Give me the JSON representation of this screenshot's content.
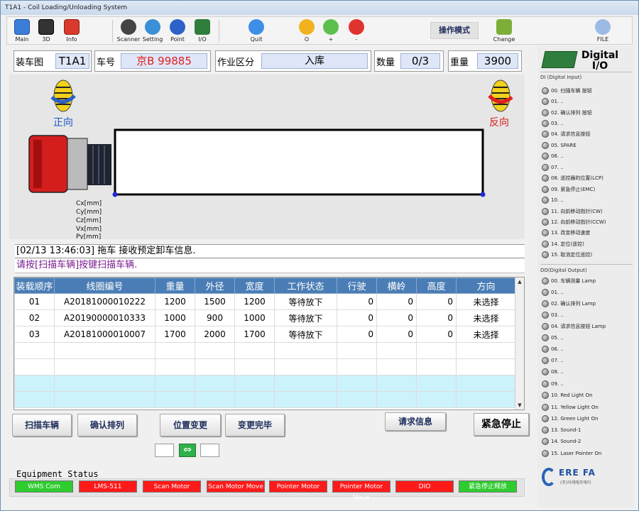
{
  "window": {
    "title": "T1A1 - Coil Loading/Unloading System"
  },
  "toolbar": {
    "main": "Main",
    "view3d": "3D",
    "info": "Info",
    "scanner": "Scanner",
    "setting": "Setting",
    "point": "Point",
    "io": "I/O",
    "quit": "Quit",
    "o": "O",
    "plus": "+",
    "minus": "-",
    "mode": "操作模式",
    "change": "Change",
    "file": "FILE"
  },
  "header": {
    "car_diagram_label": "装车图",
    "car_diagram_value": "T1A1",
    "car_no_label": "车号",
    "car_no_value": "京B 99885",
    "zone_label": "作业区分",
    "zone_value": "入库",
    "qty_label": "数量",
    "qty_value": "0/3",
    "weight_label": "重量",
    "weight_value": "3900"
  },
  "canvas": {
    "forward_label": "正向",
    "reverse_label": "反向",
    "coords": [
      "Cx[mm]",
      "Cy[mm]",
      "Cz[mm]",
      "Vx[mm]",
      "Py[mm]"
    ]
  },
  "log": {
    "message": "[02/13 13:46:03] 拖车  接收预定卸车信息.",
    "prompt": "请按[扫描车辆]按键扫描车辆."
  },
  "table": {
    "headers": [
      "装载顺序",
      "线圈编号",
      "重量",
      "外径",
      "宽度",
      "工作状态",
      "行驶",
      "横岭",
      "高度",
      "方向"
    ],
    "rows": [
      [
        "01",
        "A20181000010222",
        "1200",
        "1500",
        "1200",
        "等待放下",
        "0",
        "0",
        "0",
        "未选择"
      ],
      [
        "02",
        "A20190000010333",
        "1000",
        "900",
        "1000",
        "等待放下",
        "0",
        "0",
        "0",
        "未选择"
      ],
      [
        "03",
        "A20181000010007",
        "1700",
        "2000",
        "1700",
        "等待放下",
        "0",
        "0",
        "0",
        "未选择"
      ]
    ]
  },
  "buttons": {
    "scan": "扫描车辆",
    "confirm": "确认排列",
    "pos_change": "位置变更",
    "change_done": "变更完毕",
    "request": "请求信息",
    "estop": "紧急停止"
  },
  "equipment": {
    "title": "Equipment Status",
    "items": [
      {
        "label": "WMS Com",
        "color": "#2ecc2e"
      },
      {
        "label": "LMS-511",
        "color": "#ff1a1a"
      },
      {
        "label": "Scan Motor",
        "color": "#ff1a1a"
      },
      {
        "label": "Scan Motor Move",
        "color": "#ff1a1a"
      },
      {
        "label": "Pointer Motor",
        "color": "#ff1a1a"
      },
      {
        "label": "Pointer Motor Move",
        "color": "#ff1a1a"
      },
      {
        "label": "DIO",
        "color": "#ff1a1a"
      },
      {
        "label": "紧急停止释放",
        "color": "#2ecc2e"
      }
    ]
  },
  "io_panel": {
    "title": "Digital I/O",
    "di_title": "DI (Digital Input)",
    "di": [
      "00. 扫描车辆 按钮",
      "01. ..",
      "02. 确认排列 按钮",
      "03. ..",
      "04. 请求信息按钮",
      "05. SPARE",
      "06. ..",
      "07. ..",
      "08. 遥控器的位置(LCP)",
      "09. 紧急停止(EMC)",
      "10. ..",
      "11. 向前移动指针(CW)",
      "12. 向前移动指针(CCW)",
      "13. 改变移动速度",
      "14. 定位(遥控)",
      "15. 取消定位遥控)"
    ],
    "do_title": "DO(Digital Output)",
    "do": [
      "00. 车辆测量 Lamp",
      "01. ..",
      "02. 确认排列 Lamp",
      "03. ..",
      "04. 请求信息按钮 Lamp",
      "05. ..",
      "06. ..",
      "07. ..",
      "08. ..",
      "09. ..",
      "10. Red Light On",
      "11. Yellow Light On",
      "12. Green Light On",
      "13. Sound-1",
      "14. Sound-2",
      "15. Laser Pointer On"
    ],
    "logo_text": "ERE FA",
    "logo_sub": "(주)이레에프에이"
  }
}
